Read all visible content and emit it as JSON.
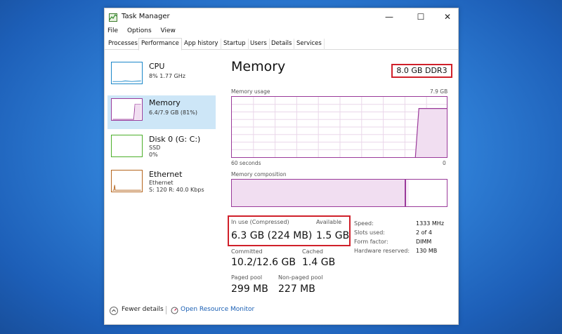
{
  "window": {
    "title": "Task Manager",
    "controls": {
      "minimize": "—",
      "maximize": "☐",
      "close": "✕"
    }
  },
  "menu": [
    "File",
    "Options",
    "View"
  ],
  "tabs": [
    "Processes",
    "Performance",
    "App history",
    "Startup",
    "Users",
    "Details",
    "Services"
  ],
  "active_tab": "Performance",
  "sidebar": [
    {
      "name": "CPU",
      "sub1": "8%  1.77 GHz",
      "sub2": "",
      "sub3": "",
      "color": "#1a87c9"
    },
    {
      "name": "Memory",
      "sub1": "6.4/7.9 GB (81%)",
      "sub2": "",
      "sub3": "",
      "color": "#9a3a9a",
      "fill": 0.81
    },
    {
      "name": "Disk 0 (G: C:)",
      "sub1": "SSD",
      "sub2": "0%",
      "sub3": "",
      "color": "#4caf2a"
    },
    {
      "name": "Ethernet",
      "sub1": "Ethernet",
      "sub2": "S: 120  R: 40.0 Kbps",
      "sub3": "",
      "color": "#b5651d"
    }
  ],
  "memory": {
    "title": "Memory",
    "spec": "8.0 GB DDR3",
    "usage_label": "Memory usage",
    "usage_max": "7.9 GB",
    "time_left": "60 seconds",
    "time_right": "0",
    "composition_label": "Memory composition",
    "in_use_label": "In use (Compressed)",
    "in_use_value": "6.3 GB (224 MB)",
    "available_label": "Available",
    "available_value": "1.5 GB",
    "committed_label": "Committed",
    "committed_value": "10.2/12.6 GB",
    "cached_label": "Cached",
    "cached_value": "1.4 GB",
    "paged_label": "Paged pool",
    "paged_value": "299 MB",
    "nonpaged_label": "Non-paged pool",
    "nonpaged_value": "227 MB",
    "details": [
      {
        "label": "Speed:",
        "value": "1333 MHz"
      },
      {
        "label": "Slots used:",
        "value": "2 of 4"
      },
      {
        "label": "Form factor:",
        "value": "DIMM"
      },
      {
        "label": "Hardware reserved:",
        "value": "130 MB"
      }
    ]
  },
  "footer": {
    "fewer_details": "Fewer details",
    "open_monitor": "Open Resource Monitor"
  },
  "colors": {
    "accent": "#9a3a9a",
    "highlight": "#d0202a",
    "link": "#1a5fb4"
  }
}
